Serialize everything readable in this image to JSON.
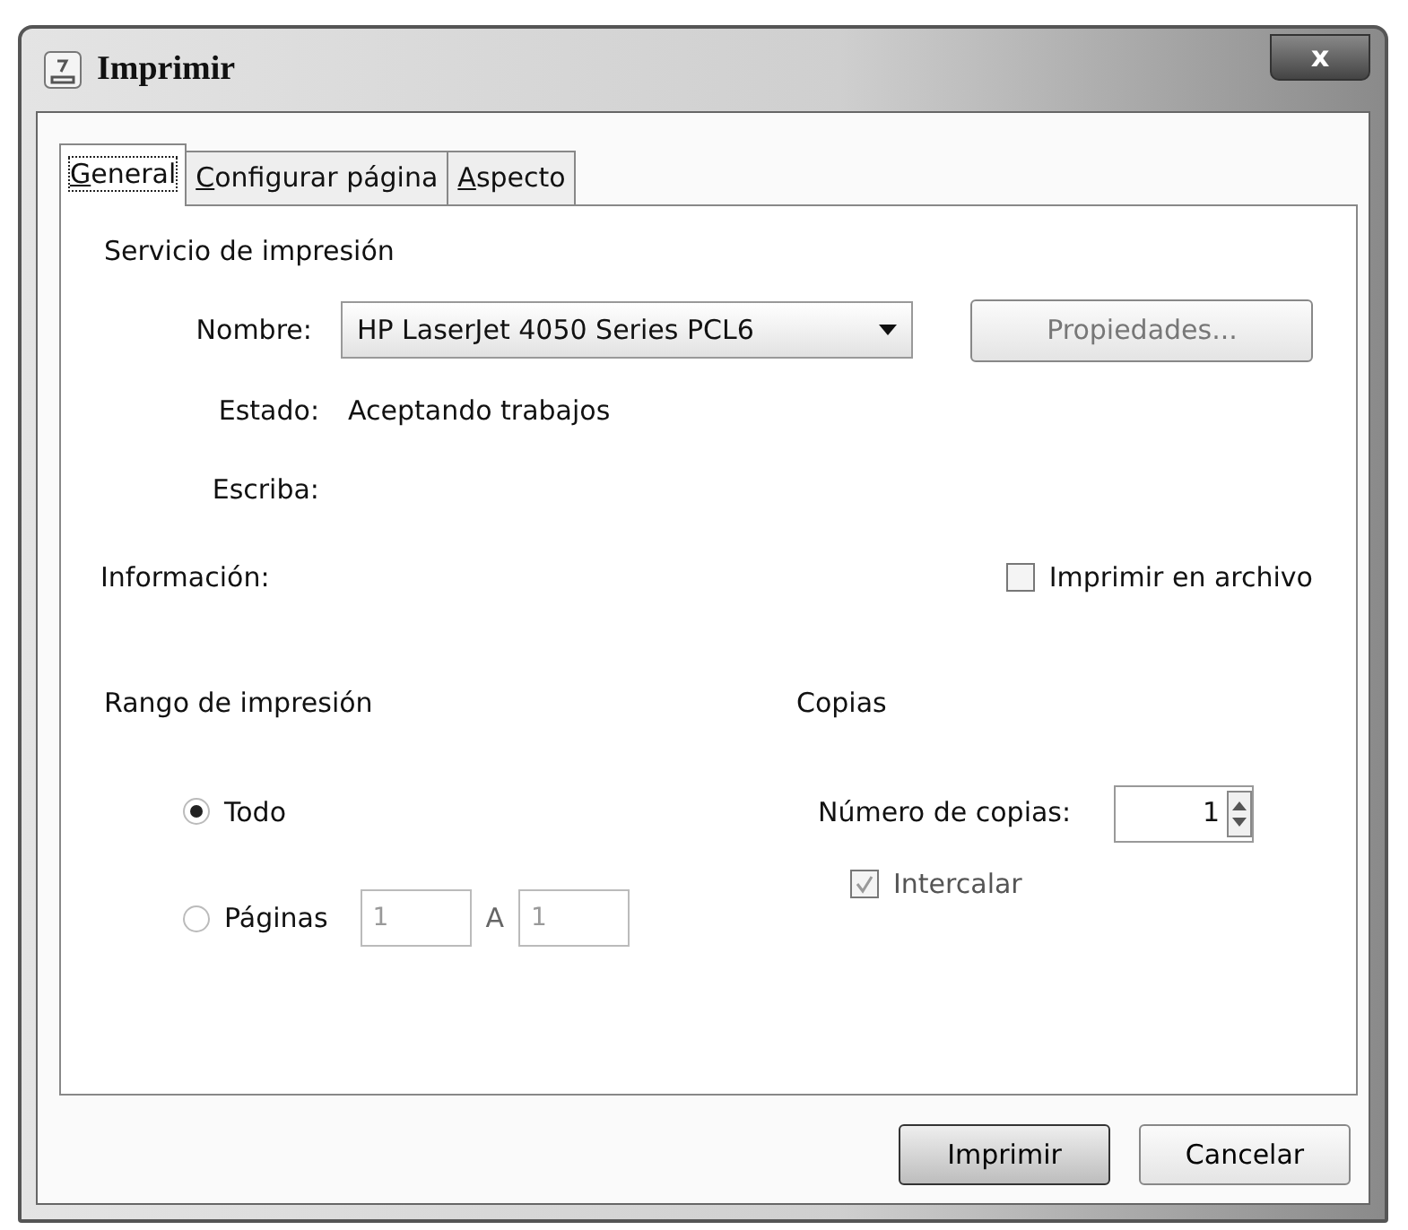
{
  "window": {
    "title": "Imprimir",
    "close_label": "x"
  },
  "tabs": [
    {
      "label": "General",
      "selected": true,
      "mnemonic_first": true
    },
    {
      "label": "Configurar página",
      "selected": false,
      "mnemonic_first": true
    },
    {
      "label": "Aspecto",
      "selected": false,
      "mnemonic_first": true
    }
  ],
  "print_service": {
    "heading": "Servicio de impresión",
    "name_label": "Nombre:",
    "printer": "HP LaserJet 4050 Series PCL6",
    "properties_button": {
      "label": "Propiedades...",
      "disabled": true
    },
    "status_label": "Estado:",
    "status": "Aceptando trabajos",
    "type_label": "Escriba:",
    "info_label": "Información:",
    "print_to_file": {
      "label": "Imprimir en archivo",
      "checked": false,
      "disabled": false
    }
  },
  "print_range": {
    "heading": "Rango de impresión",
    "options": [
      {
        "label": "Todo",
        "selected": true
      },
      {
        "label": "Páginas",
        "selected": false
      }
    ],
    "from": {
      "value": "1",
      "disabled": true
    },
    "to_label": "A",
    "to": {
      "value": "1",
      "disabled": true
    }
  },
  "copies": {
    "heading": "Copias",
    "count_label": "Número de copias:",
    "count": "1",
    "collate": {
      "label": "Intercalar",
      "checked": true,
      "disabled": true
    }
  },
  "buttons": [
    {
      "label": "Imprimir",
      "default": true
    },
    {
      "label": "Cancelar",
      "default": false
    }
  ]
}
